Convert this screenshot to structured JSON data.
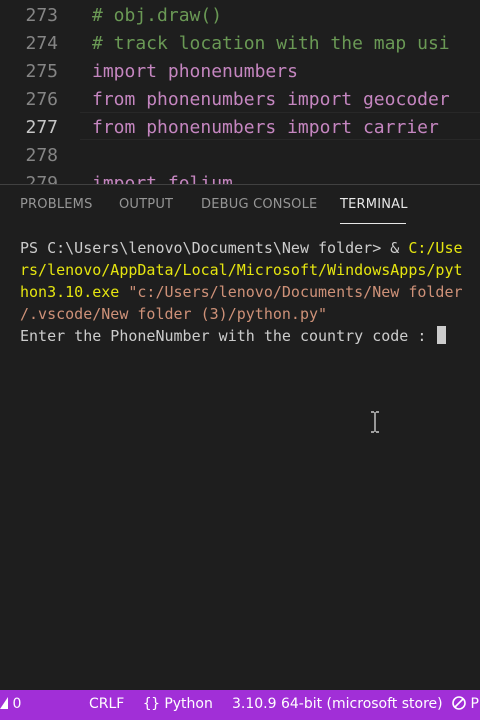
{
  "editor": {
    "lines": [
      {
        "no": "273",
        "comment": "# obj.draw()"
      },
      {
        "no": "274",
        "comment": "# track location with the map usi"
      },
      {
        "no": "275",
        "kw": "import",
        "mod": "phonenumbers"
      },
      {
        "no": "276",
        "kw": "from",
        "mod": "phonenumbers",
        "kw2": "import",
        "mod2": "geocoder"
      },
      {
        "no": "277",
        "kw": "from",
        "mod": "phonenumbers",
        "kw2": "import",
        "mod2": "carrier"
      },
      {
        "no": "278"
      },
      {
        "no": "279",
        "kw": "import",
        "mod": "folium"
      }
    ]
  },
  "panel": {
    "tabs": [
      "PROBLEMS",
      "OUTPUT",
      "DEBUG CONSOLE",
      "TERMINAL"
    ],
    "active_tab": "TERMINAL"
  },
  "terminal": {
    "prompt": "PS C:\\Users\\lenovo\\Documents\\New folder> & ",
    "cmd_part1": "C:/Use",
    "line2": "rs/lenovo/AppData/Local/Microsoft/WindowsApps/pyt",
    "line3_a": "hon3.10.exe ",
    "line3_b": "\"c:/Users/lenovo/Documents/New folder",
    "line4": "/.vscode/New folder (3)/python.py\"",
    "line5": "Enter the PhoneNumber with the country code : "
  },
  "statusbar": {
    "errors": "0",
    "eol": "CRLF",
    "language": "Python",
    "interpreter": "3.10.9 64-bit (microsoft store)",
    "trailing": "P"
  },
  "colors": {
    "statusbar": "#a12fd7",
    "comment": "#6a9955",
    "keyword": "#c586c0",
    "terminal_yellow": "#e5e510",
    "terminal_string": "#ce9178"
  }
}
